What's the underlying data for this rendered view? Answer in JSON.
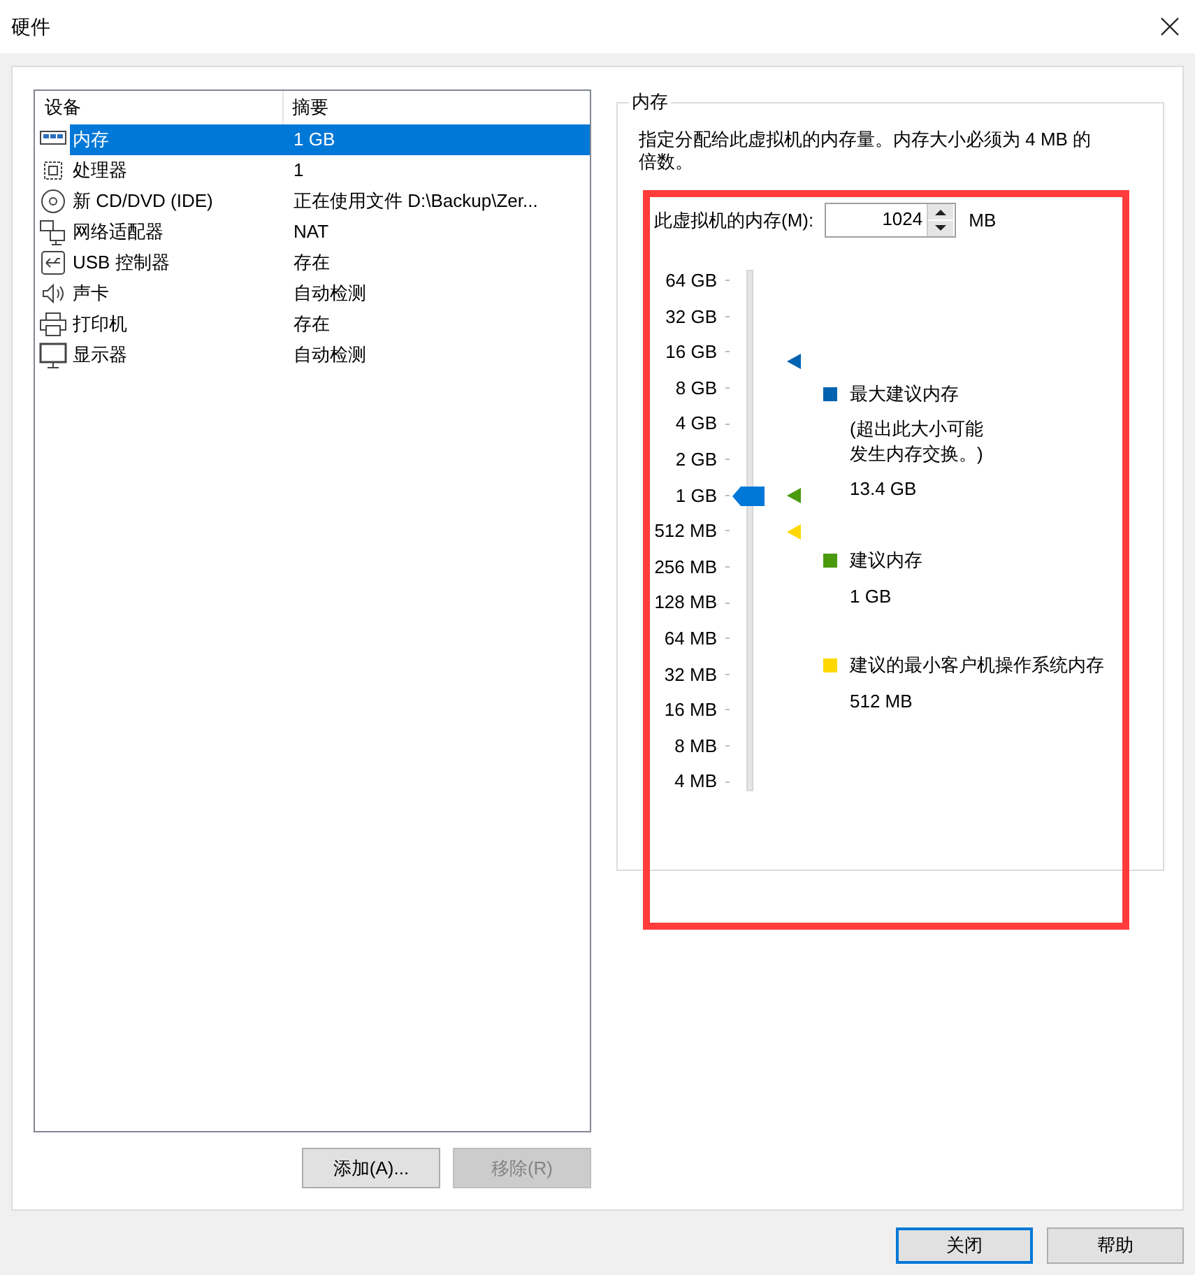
{
  "window": {
    "title": "硬件"
  },
  "devices": {
    "columns": [
      "设备",
      "摘要"
    ],
    "rows": [
      {
        "kind": "memory",
        "name": "内存",
        "summary": "1 GB",
        "selected": true
      },
      {
        "kind": "cpu",
        "name": "处理器",
        "summary": "1",
        "selected": false
      },
      {
        "kind": "disc",
        "name": "新 CD/DVD (IDE)",
        "summary": "正在使用文件 D:\\Backup\\Zer...",
        "selected": false
      },
      {
        "kind": "network",
        "name": "网络适配器",
        "summary": "NAT",
        "selected": false
      },
      {
        "kind": "usb",
        "name": "USB 控制器",
        "summary": "存在",
        "selected": false
      },
      {
        "kind": "sound",
        "name": "声卡",
        "summary": "自动检测",
        "selected": false
      },
      {
        "kind": "printer",
        "name": "打印机",
        "summary": "存在",
        "selected": false
      },
      {
        "kind": "display",
        "name": "显示器",
        "summary": "自动检测",
        "selected": false
      }
    ],
    "buttons": [
      {
        "label": "添加(A)...",
        "disabled": false
      },
      {
        "label": "移除(R)",
        "disabled": true
      }
    ]
  },
  "memory": {
    "title": "内存",
    "description": "指定分配给此虚拟机的内存量。内存大小必须为 4 MB 的倍数。",
    "field_label": "此虚拟机的内存(M):",
    "value": "1024",
    "unit": "MB",
    "slider": {
      "level": 0.571,
      "ticks": [
        "64 GB",
        "32 GB",
        "16 GB",
        "8 GB",
        "4 GB",
        "2 GB",
        "1 GB",
        "512 MB",
        "256 MB",
        "128 MB",
        "64 MB",
        "32 MB",
        "16 MB",
        "8 MB",
        "4 MB"
      ]
    },
    "legend": [
      {
        "label": "最大建议内存",
        "note": [
          "(超出此大小可能",
          "发生内存交换。)"
        ],
        "value": "13.4 GB",
        "color": "#0063b1"
      },
      {
        "label": "建议内存",
        "value": "1 GB",
        "color": "#4a9a0e"
      },
      {
        "label": "建议的最小客户机操作系统内存",
        "value": "512 MB",
        "color": "#ffd700"
      }
    ]
  },
  "footer_buttons": [
    {
      "label": "关闭",
      "default": true
    },
    {
      "label": "帮助",
      "default": false
    }
  ]
}
